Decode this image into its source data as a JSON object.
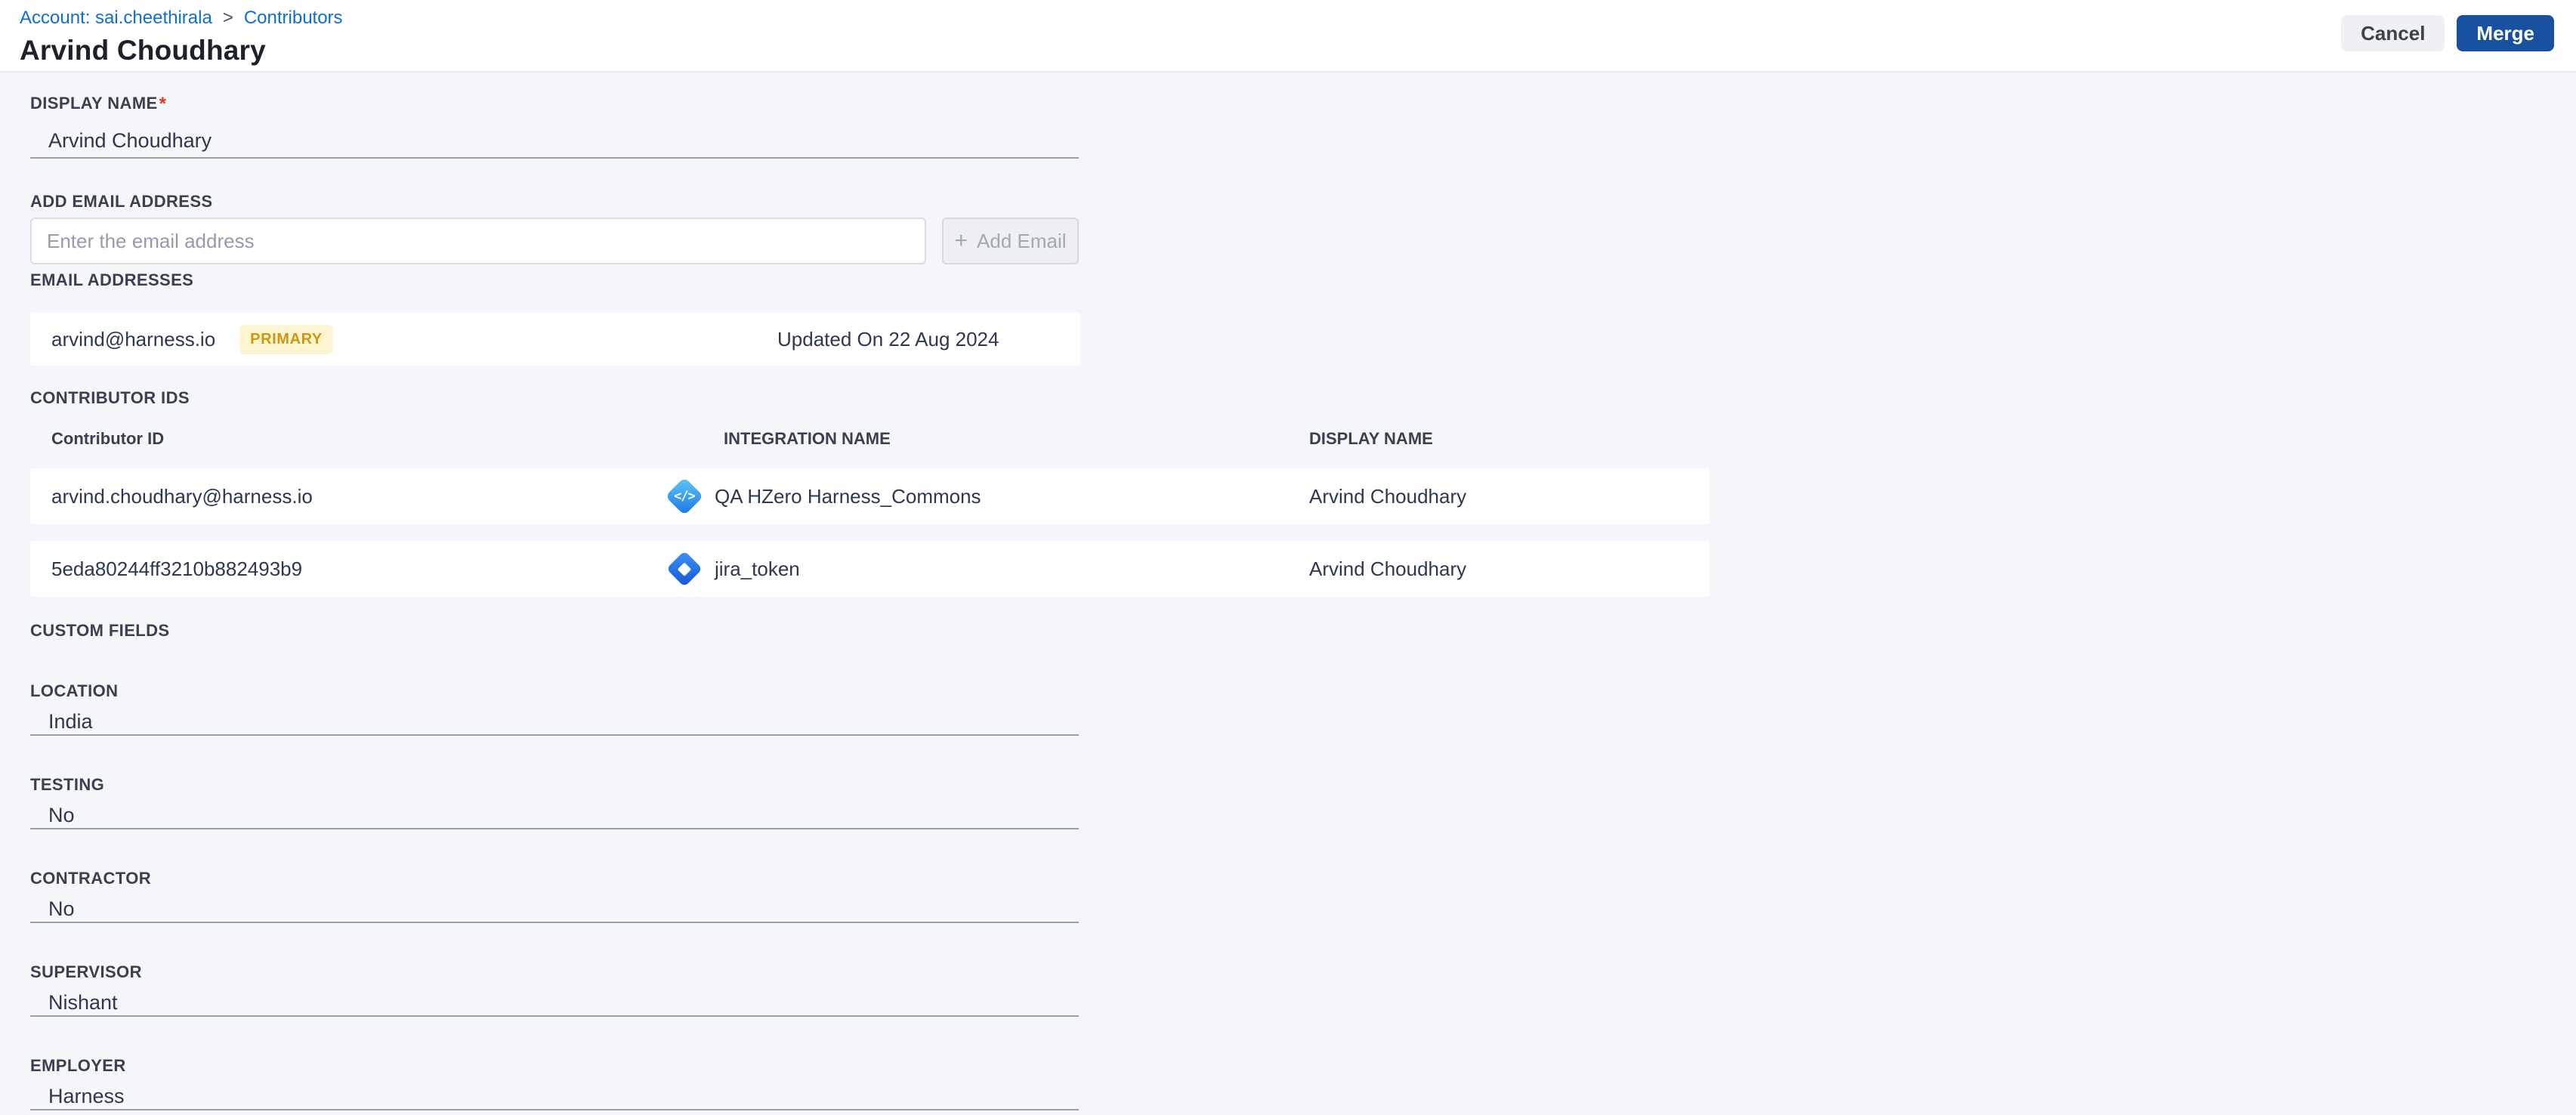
{
  "breadcrumb": {
    "account_link": "Account: sai.cheethirala",
    "separator": ">",
    "current": "Contributors"
  },
  "header": {
    "title": "Arvind Choudhary",
    "cancel_label": "Cancel",
    "merge_label": "Merge"
  },
  "display_name": {
    "label": "DISPLAY NAME",
    "required_mark": "*",
    "value": "Arvind Choudhary"
  },
  "add_email": {
    "label": "ADD EMAIL ADDRESS",
    "placeholder": "Enter the email address",
    "plus": "+",
    "button_label": "Add Email"
  },
  "email_addresses": {
    "label": "EMAIL ADDRESSES",
    "rows": [
      {
        "email": "arvind@harness.io",
        "badge": "PRIMARY",
        "updated": "Updated On 22 Aug 2024"
      }
    ]
  },
  "contributor_ids": {
    "label": "CONTRIBUTOR IDS",
    "columns": [
      "Contributor ID",
      "INTEGRATION NAME",
      "DISPLAY NAME"
    ],
    "rows": [
      {
        "id": "arvind.choudhary@harness.io",
        "icon": "code-integration-icon",
        "icon_glyph": "</>",
        "integration": "QA HZero Harness_Commons",
        "display_name": "Arvind Choudhary"
      },
      {
        "id": "5eda80244ff3210b882493b9",
        "icon": "jira-icon",
        "integration": "jira_token",
        "display_name": "Arvind Choudhary"
      }
    ]
  },
  "custom_fields": {
    "label": "CUSTOM FIELDS",
    "fields": [
      {
        "label": "LOCATION",
        "value": "India"
      },
      {
        "label": "TESTING",
        "value": "No"
      },
      {
        "label": "CONTRACTOR",
        "value": "No"
      },
      {
        "label": "SUPERVISOR",
        "value": "Nishant"
      },
      {
        "label": "EMPLOYER",
        "value": "Harness"
      }
    ]
  },
  "colors": {
    "content_background": "#f5f6fa",
    "topbar_background": "#ffffff",
    "breadcrumb_link": "#0d6fd1",
    "merge_button": "#17519f",
    "cancel_button": "#eef0f4",
    "primary_badge_bg": "#fdf5d2",
    "primary_badge_text": "#cf9610",
    "required_asterisk": "#e0352b",
    "value_text": "#2c3850",
    "code_icon_gradient": [
      "#5fc9f3",
      "#1b76e8"
    ],
    "jira_icon_gradient": [
      "#3f92f7",
      "#1257d5"
    ]
  }
}
